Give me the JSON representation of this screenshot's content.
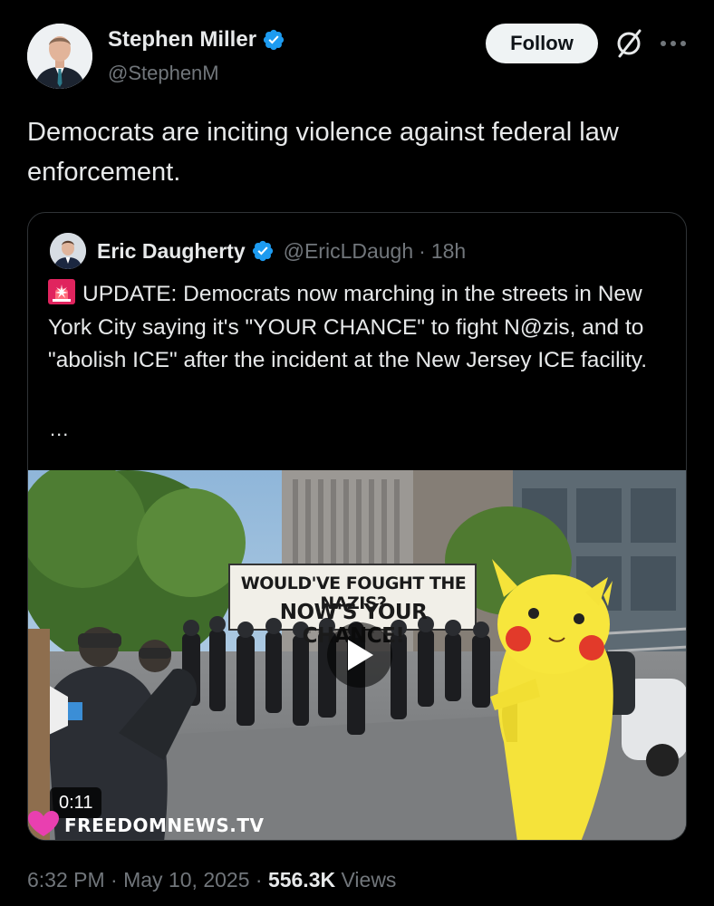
{
  "author": {
    "display_name": "Stephen Miller",
    "handle": "@StephenM",
    "avatar_icon": "person-avatar",
    "verified_icon": "verified-badge-icon",
    "verified_color": "#1d9bf0"
  },
  "actions": {
    "follow_label": "Follow",
    "grok_icon": "grok-icon",
    "more_icon": "more-icon"
  },
  "tweet": {
    "text": "Democrats are inciting violence against federal law enforcement."
  },
  "quote": {
    "display_name": "Eric Daugherty",
    "handle": "@EricLDaugh",
    "separator": "·",
    "time": "18h",
    "text": "UPDATE: Democrats now marching in the streets in New York City saying it's \"YOUR CHANCE\" to fight N@zis, and to \"abolish ICE\" after the incident at the New Jersey ICE facility.",
    "emoji_icon": "siren-icon",
    "ellipsis": "...",
    "video": {
      "banner_line1": "WOULD'VE FOUGHT THE NAZIS?",
      "banner_line2": "NOW'S YOUR CHANCE!",
      "duration": "0:11",
      "watermark": "FREEDOMNEWS.TV",
      "play_icon": "play-icon"
    }
  },
  "meta": {
    "time": "6:32 PM",
    "separator": "·",
    "date": "May 10, 2025",
    "views_count": "556.3K",
    "views_label": "Views"
  },
  "colors": {
    "background": "#000000",
    "text": "#e7e9ea",
    "secondary": "#71767b",
    "accent": "#1d9bf0",
    "border": "#2f3336"
  }
}
